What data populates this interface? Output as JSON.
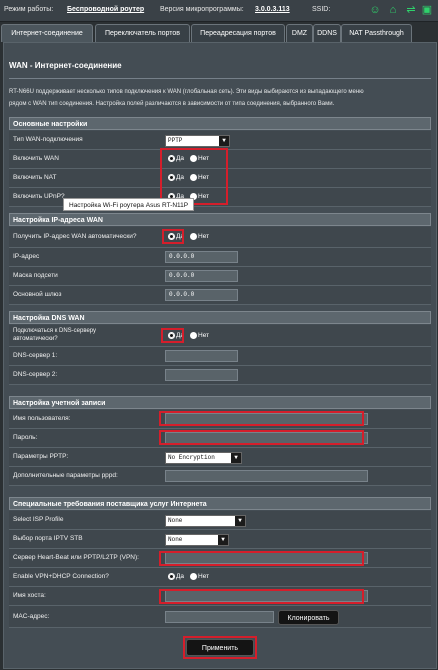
{
  "topbar": {
    "mode_label": "Режим работы:",
    "mode_value": "Беспроводной роутер",
    "fw_label": "Версия микропрограммы:",
    "fw_value": "3.0.0.3.113",
    "ssid_label": "SSID:"
  },
  "tabs": [
    "Интернет-соединение",
    "Переключатель портов",
    "Переадресация портов",
    "DMZ",
    "DDNS",
    "NAT Passthrough"
  ],
  "page": {
    "title": "WAN - Интернет-соединение",
    "desc1": "RT-N66U поддерживает несколько типов подключения к WAN (глобальная сеть). Эти виды выбираются из выпадающего меню",
    "desc2": "рядом с WAN тип соединения. Настройка полей различаются в зависимости от типа соединения, выбранного Вами."
  },
  "sections": {
    "basic": "Основные настройки",
    "ip": "Настройка IP-адреса WAN",
    "dns": "Настройка DNS WAN",
    "account": "Настройка учетной записи",
    "isp": "Специальные требования поставщика услуг Интернета"
  },
  "labels": {
    "wan_type": "Тип WAN-подключения",
    "enable_wan": "Включить WAN",
    "enable_nat": "Включить NAT",
    "enable_upnp": "Включить UPnP?",
    "get_ip_auto": "Получить IP-адрес WAN автоматически?",
    "ip": "IP-адрес",
    "mask": "Маска подсети",
    "gateway": "Основной шлюз",
    "dns_auto_1": "Подключаться к DNS-серверу",
    "dns_auto_2": "автоматически?",
    "dns1": "DNS-сервер 1:",
    "dns2": "DNS-сервер 2:",
    "username": "Имя пользователя:",
    "password": "Пароль:",
    "pptp_params": "Параметры PPTP:",
    "pppd_params": "Дополнительные параметры pppd:",
    "isp_profile": "Select ISP Profile",
    "iptv_port": "Выбор порта IPTV STB",
    "heartbeat": "Сервер Heart-Beat или PPTP/L2TP (VPN):",
    "vpn_dhcp": "Enable VPN+DHCP Connection?",
    "hostname": "Имя хоста:",
    "mac": "MAC-адрес:"
  },
  "values": {
    "wan_type": "PPTP",
    "ip": "0.0.0.0",
    "mask": "0.0.0.0",
    "gateway": "0.0.0.0",
    "pptp_option": "No Encryption",
    "isp_profile": "None",
    "iptv_port": "None"
  },
  "radio": {
    "yes": "Да",
    "no": "Нет"
  },
  "tooltip": "Настройка Wi-Fi роутера Asus RT-N11P",
  "buttons": {
    "clone": "Клонировать",
    "apply": "Применить"
  },
  "colors": {
    "highlight": "#d51e2b",
    "status_icon": "#2fd16b"
  }
}
